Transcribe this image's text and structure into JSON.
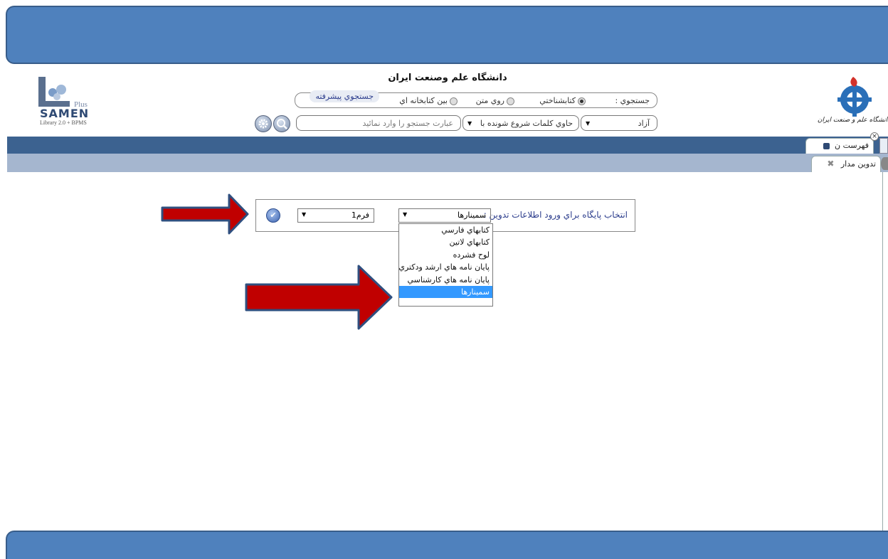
{
  "header": {
    "university_title": "دانشگاه علم وصنعت ايران",
    "search_label": "جستجوي :",
    "radio_options": [
      "كتابشناختي",
      "روي متن",
      "بين كتابخانه اي"
    ],
    "selected_radio": "كتابشناختي",
    "advanced_search": "جستجوي پيشرفته",
    "search_mode_value": "آزاد",
    "match_mode_value": "حاوي كلمات شروع شونده با",
    "search_placeholder": "عبارت جستجو را وارد نمائيد"
  },
  "logos": {
    "samen_text": "SAMEN",
    "samen_plus": "Plus",
    "samen_sub": "Library 2.0 + BPMS",
    "iust_text": "دانشگاه علم و صنعت ایران"
  },
  "tabs": {
    "catalog_tab": "فهرست ن",
    "edit_tab": "تدوين مدار"
  },
  "form": {
    "prompt": "انتخاب پايگاه براي ورود اطلاعات تدوين :",
    "db_selected": "سمينارها",
    "form_selected": "فرم1",
    "db_options": [
      "كتابهاي فارسي",
      "كتابهاي لاتين",
      "لوح فشرده",
      "پايان نامه هاي ارشد ودكتري",
      "پايان نامه هاي كارشناسي",
      "سمينارها"
    ]
  },
  "colors": {
    "banner": "#4f81bd",
    "dark_bar": "#3c6290",
    "light_bar": "#a5b6cf",
    "arrow_fill": "#c00000",
    "arrow_stroke": "#2f4f7f",
    "highlight": "#3399ff"
  }
}
